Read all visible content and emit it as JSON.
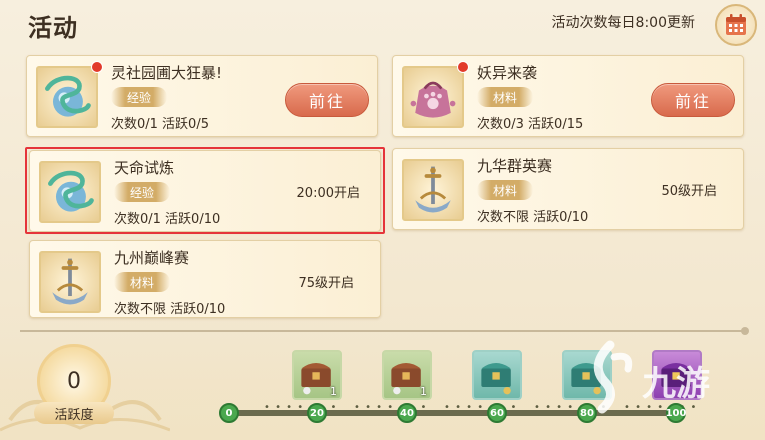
{
  "header": {
    "title": "活动",
    "refresh_note": "活动次数每日8:00更新"
  },
  "cards": [
    {
      "name": "灵社园圃大狂暴!",
      "tag": "经验",
      "stats": "次数0/1 活跃0/5",
      "button": "前往",
      "icon": "spirit-orb-icon",
      "has_dot": true
    },
    {
      "name": "妖异来袭",
      "tag": "材料",
      "stats": "次数0/3 活跃0/15",
      "button": "前往",
      "icon": "demon-pouch-icon",
      "has_dot": true
    },
    {
      "name": "天命试炼",
      "tag": "经验",
      "stats": "次数0/1 活跃0/10",
      "open_text": "20:00开启",
      "icon": "spirit-orb-icon",
      "selected": true
    },
    {
      "name": "九华群英赛",
      "tag": "材料",
      "stats": "次数不限 活跃0/10",
      "open_text": "50级开启",
      "icon": "sword-emblem-icon"
    },
    {
      "name": "九州巅峰赛",
      "tag": "材料",
      "stats": "次数不限 活跃0/10",
      "open_text": "75级开启",
      "icon": "sword-emblem-icon"
    }
  ],
  "activity": {
    "value": "0",
    "label": "活跃度"
  },
  "progress": {
    "current": 0,
    "milestones": [
      "0",
      "20",
      "40",
      "60",
      "80",
      "100"
    ]
  },
  "rewards": [
    {
      "icon": "bronze-chest-icon",
      "count": "1"
    },
    {
      "icon": "bronze-chest-icon",
      "count": "1"
    },
    {
      "icon": "jade-chest-icon",
      "count": ""
    },
    {
      "icon": "jade-chest-icon",
      "count": ""
    },
    {
      "icon": "purple-chest-icon",
      "count": ""
    }
  ],
  "watermark": "九游",
  "colors": {
    "accent_red": "#e5343a",
    "go_button": "#d86a4c",
    "tag_gold": "#d3ac67",
    "progress_green": "#4aa84e"
  }
}
